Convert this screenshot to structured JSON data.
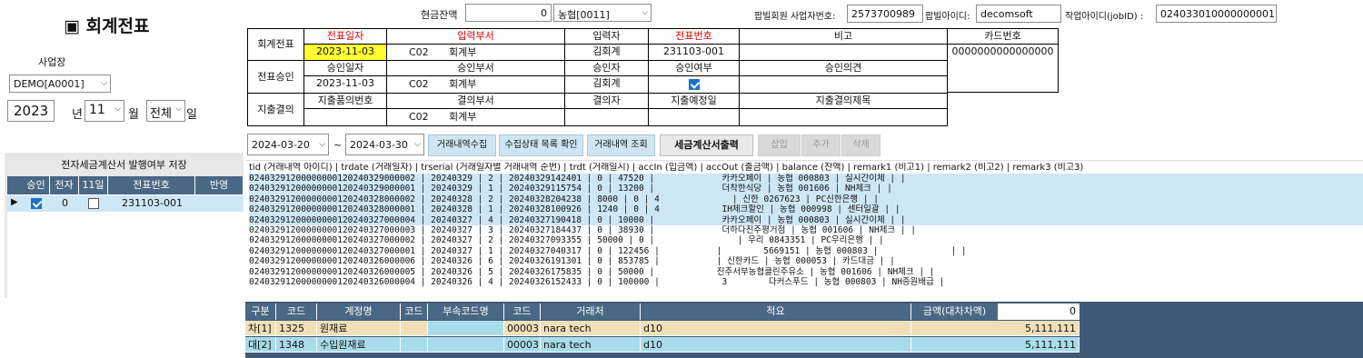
{
  "title": "▣ 회계전표",
  "left": {
    "business_label": "사업장",
    "business_value": "DEMO[A0001]",
    "year": "2023",
    "year_unit": "년",
    "month": "11",
    "month_unit": "월",
    "day": "전체",
    "day_unit": "일",
    "save_panel_title": "전자세금계산서 발행여부 저장",
    "grid_headers": [
      "승인",
      "전자",
      "11일",
      "전표번호",
      "반영"
    ],
    "grid_row": {
      "marker": "▶",
      "electronic": "0",
      "voucher_no": "231103-001"
    }
  },
  "top": {
    "cash_label": "현금잔액",
    "cash_value": "0",
    "bank_value": "농협[0011]",
    "member_biz_label": "팝빌회원 사업자번호:",
    "member_biz_value": "2573700989",
    "popbill_id_label": "팝빌아이디:",
    "popbill_id_value": "decomsoft",
    "job_id_label": "작업아이디(jobID) :",
    "job_id_value": "024033010000000001"
  },
  "voucher": {
    "row1_label": "회계전표",
    "row2_label": "전표승인",
    "row3_label": "지출결의",
    "h_date": "전표일자",
    "h_dept": "입력부서",
    "h_inputter": "입력자",
    "h_voucher_no": "전표번호",
    "h_memo": "비고",
    "h_card": "카드번호",
    "date": "2023-11-03",
    "dept_code": "C02",
    "dept_name": "회계부",
    "inputter": "김회계",
    "voucher_no": "231103-001",
    "card_no": "0000000000000000",
    "h_appr_date": "승인일자",
    "h_appr_dept": "승인부서",
    "h_approver": "승인자",
    "h_appr_yn": "승인여부",
    "h_appr_opinion": "승인의견",
    "appr_date": "2023-11-03",
    "appr_dept_code": "C02",
    "appr_dept_name": "회계부",
    "approver": "김회계",
    "h_exp_no": "지출품의번호",
    "h_resolve_dept": "결의부서",
    "h_resolver": "결의자",
    "h_exp_date": "지출예정일",
    "h_exp_title": "지출결의제목",
    "resolve_dept_code": "C02",
    "resolve_dept_name": "회계부"
  },
  "toolbar": {
    "from_date": "2024-03-20",
    "tilde": "~",
    "to_date": "2024-03-30",
    "collect": "거래내역수집",
    "status_check": "수집상태 목록 확인",
    "query": "거래내역 조회",
    "tax_print": "세금계산서출력",
    "insert": "삽입",
    "add": "추가",
    "delete": "삭제"
  },
  "tx_header": "tid (거래내역 아이디) | trdate (거래일자) | trserial (거래일자별 거래내역 순번) | trdt (거래일시) | accIn (입금액) | accOut (출금액) | balance (잔액) | remark1 (비고1) | remark2 (비고2) | remark3 (비고3)",
  "tx_lines": [
    "02403291200000000120240329000002 | 20240329 | 2 | 20240329142401 | 0 | 47520 |             카카오페이 | 농협 000803 | 실시간이체 | |",
    "02403291200000000120240329000001 | 20240329 | 1 | 20240329115754 | 0 | 13200 |             더착한식당 | 농협 001606 | NH체크 | |",
    "02403291200000000120240328000002 | 20240328 | 2 | 20240328204238 | 8000 | 0 | 4              | 신한 0267623 | PC신한은행 | |",
    "02403291200000000120240328000001 | 20240328 | 1 | 20240328100926 | 1240 | 0 | 4            IH체크할인 | 농협 000998 | 센터일괄 | |",
    "02403291200000000120240327000004 | 20240327 | 4 | 20240327190418 | 0 | 10000 |             카카오페이 | 농협 000803 | 실시간이체 | |",
    "02403291200000000120240327000003 | 20240327 | 3 | 20240327184437 | 0 | 38930 |             더하다진주평거점 | 농협 001606 | NH체크 | |",
    "02403291200000000120240327000002 | 20240327 | 2 | 20240327093355 | 50000 | 0 |                | 우리 0843351 | PC우리은행 | |",
    "02403291200000000120240327000001 | 20240327 | 1 | 20240327040317 | 0 | 122456 |           |        5669151 | 농협 000803 |              | |",
    "02403291200000000120240326000006 | 20240326 | 6 | 20240326191301 | 0 | 853785 |           | 신한카드 | 농협 000053 | 카드대금 | |",
    "02403291200000000120240326000005 | 20240326 | 5 | 20240326175835 | 0 | 50000 |            진주서부농협클린주유소 | 농협 001606 | NH체크 | |",
    "02403291200000000120240326000004 | 20240326 | 4 | 20240326152433 | 0 | 100000 |            3        다커스푸드 | 농협 000803 | NH증원배급 |"
  ],
  "journal": {
    "headers": [
      "구분",
      "코드",
      "계정명",
      "코드",
      "부속코드명",
      "코드",
      "거래처",
      "적요",
      "금액(대차차액)"
    ],
    "diff": "0",
    "rows": [
      {
        "side": "차[1]",
        "code": "1325",
        "account": "원재료",
        "sub_code": "",
        "sub_name": "",
        "vendor_code": "00003",
        "vendor": "nara tech",
        "memo": "d10",
        "amount": "5,111,111"
      },
      {
        "side": "대[2]",
        "code": "1348",
        "account": "수입원재료",
        "sub_code": "",
        "sub_name": "",
        "vendor_code": "00003",
        "vendor": "nara tech",
        "memo": "d10",
        "amount": "5,111,111"
      }
    ]
  }
}
